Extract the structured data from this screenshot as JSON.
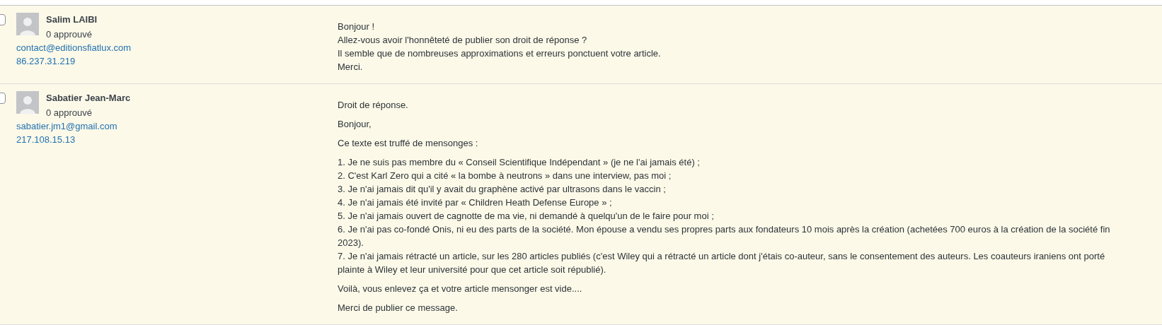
{
  "comments": [
    {
      "checked": false,
      "author": "Salim LAIBI",
      "approved": "0 approuvé",
      "email": "contact@editionsfiatlux.com",
      "ip": "86.237.31.219",
      "paragraphs": [
        [
          "Bonjour !",
          "Allez-vous avoir l'honnêteté de publier son droit de réponse ?",
          "Il semble que de nombreuses approximations et erreurs ponctuent votre article.",
          "Merci."
        ]
      ]
    },
    {
      "checked": false,
      "author": "Sabatier Jean-Marc",
      "approved": "0 approuvé",
      "email": "sabatier.jm1@gmail.com",
      "ip": "217.108.15.13",
      "paragraphs": [
        [
          "Droit de réponse."
        ],
        [
          "Bonjour,"
        ],
        [
          "Ce texte est truffé de mensonges :"
        ],
        [
          "1. Je ne suis pas membre du « Conseil Scientifique Indépendant » (je ne l'ai jamais été) ;",
          "2. C'est Karl Zero qui a cité « la bombe à neutrons » dans une interview, pas moi ;",
          "3. Je n'ai jamais dit qu'il y avait du graphène activé par ultrasons dans le vaccin ;",
          "4. Je n'ai jamais été invité par « Children Heath Defense Europe » ;",
          "5. Je n'ai jamais ouvert de cagnotte de ma vie, ni demandé à quelqu'un de le faire pour moi ;",
          "6. Je n'ai pas co-fondé Onis, ni eu des parts de la société. Mon épouse a vendu ses propres parts aux fondateurs 10 mois après la création (achetées 700 euros à la création de la société fin 2023).",
          "7. Je n'ai jamais rétracté un article, sur les 280 articles publiés (c'est Wiley qui a rétracté un article dont j'étais co-auteur, sans le consentement des auteurs. Les coauteurs iraniens ont porté plainte à Wiley et leur université pour que cet article soit républié)."
        ],
        [
          "Voilà, vous enlevez ça et votre article mensonger est vide...."
        ],
        [
          "Merci de publier ce message."
        ]
      ]
    }
  ]
}
